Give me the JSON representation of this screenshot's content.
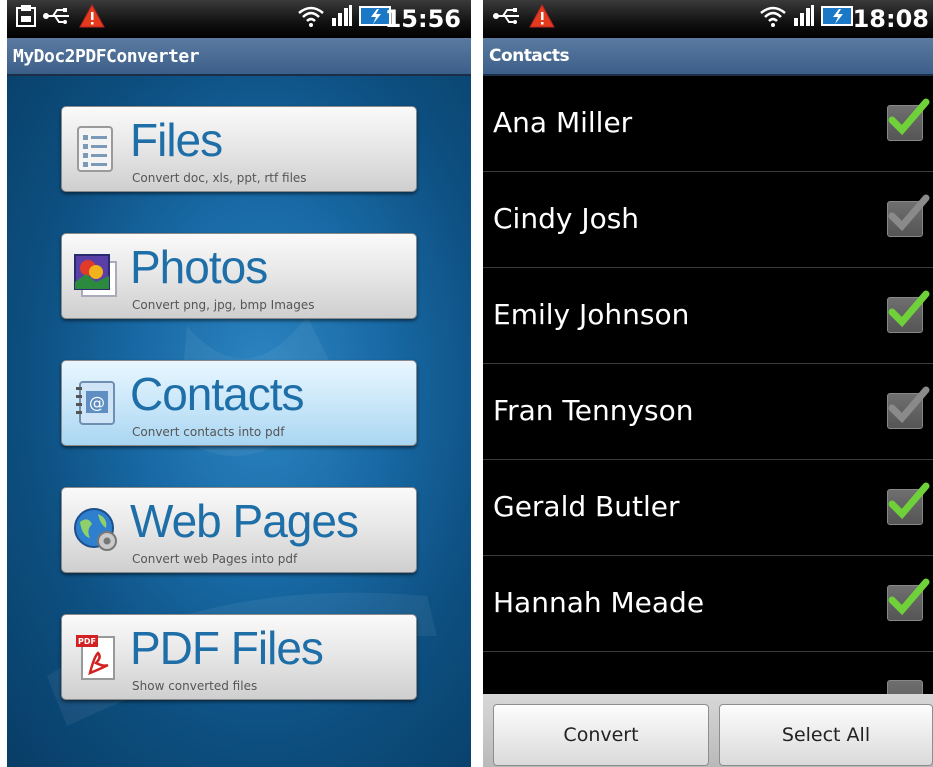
{
  "left": {
    "status": {
      "time": "15:56"
    },
    "app_title": "MyDoc2PDFConverter",
    "menu": [
      {
        "label": "Files",
        "sub": "Convert doc, xls, ppt, rtf files",
        "icon": "file-list-icon"
      },
      {
        "label": "Photos",
        "sub": "Convert png, jpg, bmp Images",
        "icon": "photo-icon"
      },
      {
        "label": "Contacts",
        "sub": "Convert contacts into pdf",
        "icon": "address-book-icon"
      },
      {
        "label": "Web Pages",
        "sub": "Convert web Pages into pdf",
        "icon": "globe-gear-icon"
      },
      {
        "label": "PDF Files",
        "sub": "Show converted files",
        "icon": "pdf-icon",
        "badge": "PDF"
      }
    ]
  },
  "right": {
    "status": {
      "time": "18:08"
    },
    "title": "Contacts",
    "contacts": [
      {
        "name": "Ana Miller",
        "checked": true
      },
      {
        "name": "Cindy Josh",
        "checked": false
      },
      {
        "name": "Emily Johnson",
        "checked": true
      },
      {
        "name": "Fran Tennyson",
        "checked": false
      },
      {
        "name": "Gerald Butler",
        "checked": true
      },
      {
        "name": "Hannah Meade",
        "checked": true
      }
    ],
    "buttons": {
      "convert": "Convert",
      "select_all": "Select All"
    }
  },
  "colors": {
    "accent": "#1e6ea8",
    "check": "#6fd13a",
    "titlebar": "#4a6d96"
  }
}
